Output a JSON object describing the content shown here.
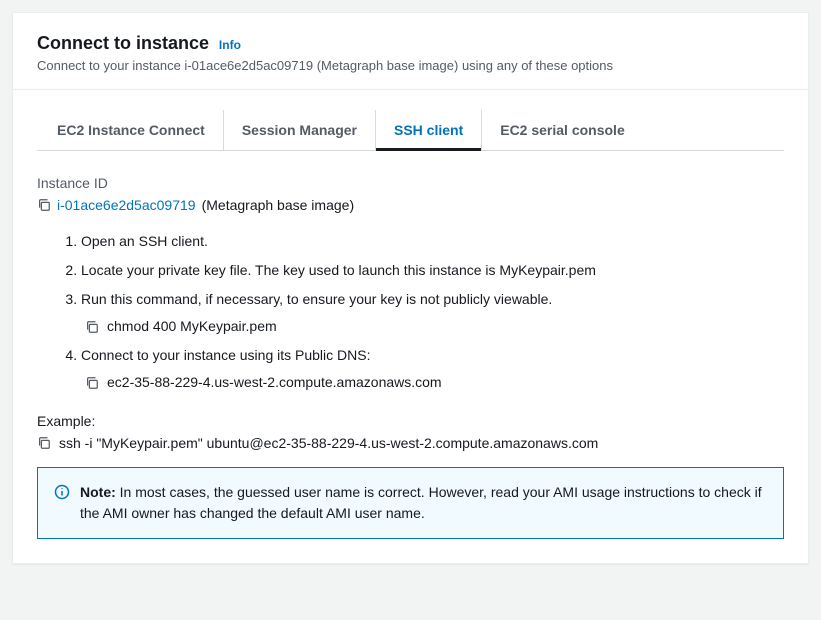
{
  "header": {
    "title": "Connect to instance",
    "info": "Info",
    "subtitle": "Connect to your instance i-01ace6e2d5ac09719 (Metagraph base image) using any of these options"
  },
  "tabs": [
    {
      "label": "EC2 Instance Connect"
    },
    {
      "label": "Session Manager"
    },
    {
      "label": "SSH client"
    },
    {
      "label": "EC2 serial console"
    }
  ],
  "instance": {
    "label": "Instance ID",
    "id": "i-01ace6e2d5ac09719",
    "name_suffix": " (Metagraph base image)"
  },
  "steps": {
    "s1": "Open an SSH client.",
    "s2": "Locate your private key file. The key used to launch this instance is MyKeypair.pem",
    "s3": "Run this command, if necessary, to ensure your key is not publicly viewable.",
    "s3_cmd": "chmod 400 MyKeypair.pem",
    "s4": "Connect to your instance using its Public DNS:",
    "s4_dns": "ec2-35-88-229-4.us-west-2.compute.amazonaws.com"
  },
  "example": {
    "label": "Example:",
    "cmd": "ssh -i \"MyKeypair.pem\" ubuntu@ec2-35-88-229-4.us-west-2.compute.amazonaws.com"
  },
  "note": {
    "bold": "Note:",
    "text": " In most cases, the guessed user name is correct. However, read your AMI usage instructions to check if the AMI owner has changed the default AMI user name."
  }
}
